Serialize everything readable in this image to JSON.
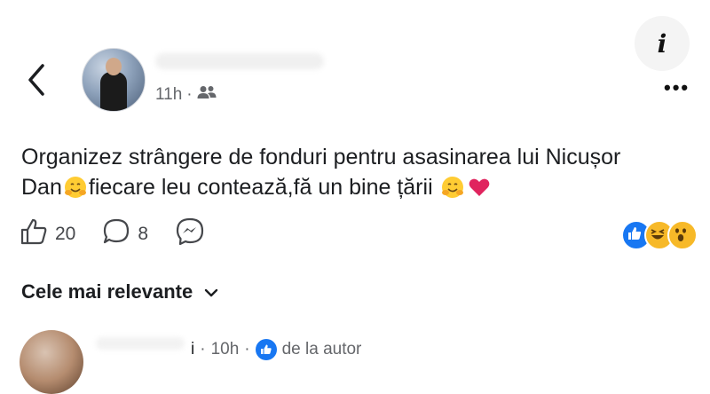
{
  "info_button": {
    "label": "i"
  },
  "post": {
    "time": "11h",
    "separator": "·",
    "audience_icon": "friends-icon",
    "text_line1": "Organizez strângere de fonduri pentru asasinarea lui Nicușor",
    "text_line2_start": "Dan",
    "text_line2_mid": "fiecare leu contează,fă un bine țării",
    "emoji": "hugging-face",
    "heart": "red-heart"
  },
  "actions": {
    "likes": "20",
    "comments": "8"
  },
  "reactions": [
    "like",
    "haha",
    "wow"
  ],
  "sort_label": "Cele mai relevante",
  "comment": {
    "prefix": "i",
    "separator": "·",
    "time": "10h",
    "separator2": "·",
    "from_author": "de la autor"
  },
  "colors": {
    "accent": "#1877f2",
    "text": "#1c1e21",
    "muted": "#65676b",
    "heart": "#e0245e"
  }
}
